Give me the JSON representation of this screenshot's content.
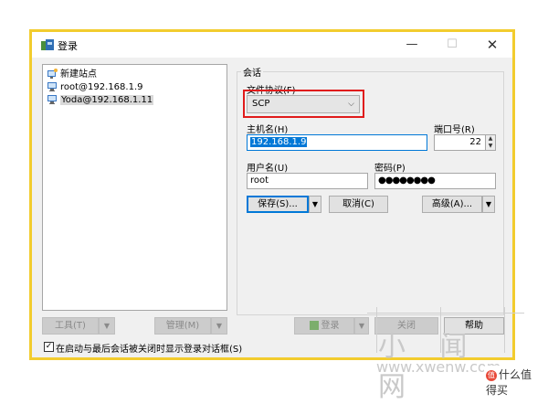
{
  "window": {
    "title": "登录",
    "controls": {
      "minimize": "—",
      "maximize": "☐",
      "close": "✕"
    }
  },
  "sites": [
    {
      "label": "新建站点",
      "icon": "new-site-icon"
    },
    {
      "label": "root@192.168.1.9",
      "icon": "monitor-icon"
    },
    {
      "label": "Yoda@192.168.1.11",
      "icon": "monitor-icon",
      "selected": true
    }
  ],
  "session": {
    "group_label": "会话",
    "protocol_label": "文件协议(F)",
    "protocol_value": "SCP",
    "host_label": "主机名(H)",
    "host_value": "192.168.1.9",
    "port_label": "端口号(R)",
    "port_value": "22",
    "user_label": "用户名(U)",
    "user_value": "root",
    "password_label": "密码(P)",
    "password_value": "●●●●●●●●",
    "save_label": "保存(S)...",
    "cancel_label": "取消(C)",
    "advanced_label": "高级(A)..."
  },
  "footer": {
    "tools_label": "工具(T)",
    "manage_label": "管理(M)",
    "login_label": "登录",
    "close_label": "关闭",
    "help_label": "帮助",
    "checkbox_label": "在启动与最后会话被关闭时显示登录对话框(S)",
    "checkbox_checked": true
  },
  "watermark": {
    "big_text": "小 闻 网",
    "url": "www.xwenw.com",
    "brand": "什么值得买",
    "brand_logo": "值"
  },
  "colors": {
    "accent": "#0078d7",
    "frame": "#f2cc2e",
    "highlight_box": "#e01b1b"
  }
}
